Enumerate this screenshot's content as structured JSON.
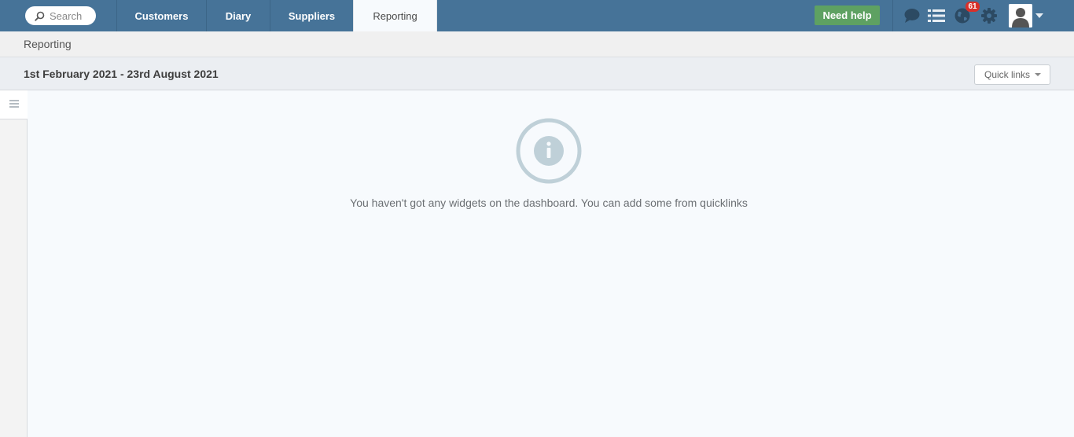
{
  "search": {
    "placeholder": "Search"
  },
  "nav": {
    "tabs": [
      {
        "label": "Customers"
      },
      {
        "label": "Diary"
      },
      {
        "label": "Suppliers"
      },
      {
        "label": "Reporting",
        "active": true
      }
    ]
  },
  "header": {
    "help_label": "Need help",
    "notification_count": "61",
    "icons": [
      "chat-icon",
      "list-icon",
      "globe-icon",
      "gear-icon",
      "user-avatar-icon"
    ]
  },
  "breadcrumb": {
    "current": "Reporting"
  },
  "toolbar": {
    "date_range": "1st February 2021 - 23rd August 2021",
    "quick_links_label": "Quick links"
  },
  "dashboard": {
    "empty_message": "You haven't got any widgets on the dashboard. You can add some from quicklinks"
  },
  "colors": {
    "topbar": "#467398",
    "help_button": "#5ea162",
    "badge": "#d9302a",
    "info_icon": "#bfd0d8"
  }
}
